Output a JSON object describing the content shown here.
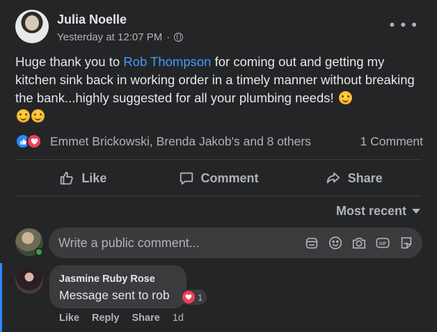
{
  "post": {
    "author": "Julia Noelle",
    "timestamp": "Yesterday at 12:07 PM",
    "separator": "·",
    "more_icon": "more-dots-icon",
    "text_before": "Huge thank you to ",
    "mention": "Rob Thompson",
    "text_after": " for coming out and getting my kitchen sink back in working order in a timely manner without breaking the bank...highly suggested for all your plumbing needs! ",
    "emoji_count": 3
  },
  "reactions": {
    "icons": [
      "like-reaction-icon",
      "love-reaction-icon"
    ],
    "summary": "Emmet Brickowski, Brenda Jakob's and 8 others",
    "comment_count": "1 Comment"
  },
  "actions": {
    "like": "Like",
    "comment": "Comment",
    "share": "Share"
  },
  "sort": {
    "label": "Most recent"
  },
  "composer": {
    "placeholder": "Write a public comment...",
    "icons": [
      "sticker-icon",
      "emoji-icon",
      "camera-icon",
      "gif-icon",
      "avatar-sticker-icon"
    ]
  },
  "comments": [
    {
      "author": "Jasmine Ruby Rose",
      "text": "Message sent to rob",
      "reaction_count": "1",
      "like": "Like",
      "reply": "Reply",
      "share": "Share",
      "age": "1d"
    }
  ],
  "colors": {
    "background": "#242526",
    "bubble": "#3a3b3c",
    "mention": "#4599ff",
    "like_blue": "#2d88ff",
    "love_red": "#f33e58",
    "online_green": "#31a24c",
    "secondary_text": "#b0b3b8"
  }
}
